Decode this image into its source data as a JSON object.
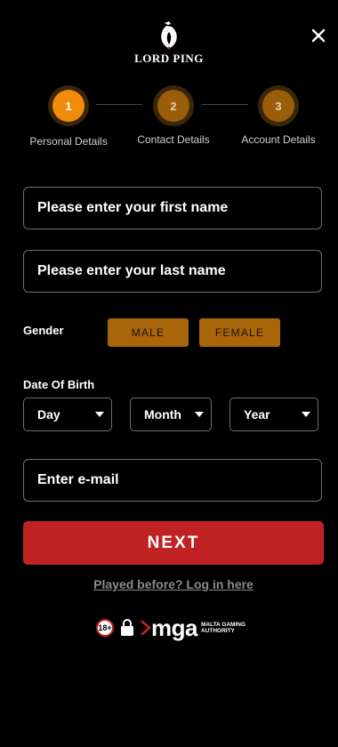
{
  "brand": {
    "name": "LORD PING"
  },
  "stepper": {
    "steps": [
      {
        "number": "1",
        "label": "Personal Details",
        "state": "active"
      },
      {
        "number": "2",
        "label": "Contact Details",
        "state": "inactive"
      },
      {
        "number": "3",
        "label": "Account Details",
        "state": "inactive"
      }
    ]
  },
  "form": {
    "first_name_placeholder": "Please enter your first name",
    "last_name_placeholder": "Please enter your last name",
    "gender_label": "Gender",
    "gender_options": [
      "MALE",
      "FEMALE"
    ],
    "dob_label": "Date Of Birth",
    "dob_selects": [
      "Day",
      "Month",
      "Year"
    ],
    "email_placeholder": "Enter e-mail",
    "next_label": "NEXT",
    "login_link": "Played before? Log in here"
  },
  "footer": {
    "age_badge": "18+",
    "mga_logo": "mga",
    "mga_subtitle_line1": "MALTA GAMING",
    "mga_subtitle_line2": "AUTHORITY"
  },
  "colors": {
    "accent_orange": "#f08c0a",
    "gender_button": "#a8650a",
    "next_button": "#c02223",
    "background": "#000000"
  },
  "icons": [
    "lord-ping-logo-icon",
    "close-icon",
    "chevron-down-icon",
    "padlock-icon",
    "mga-arrow-icon"
  ]
}
